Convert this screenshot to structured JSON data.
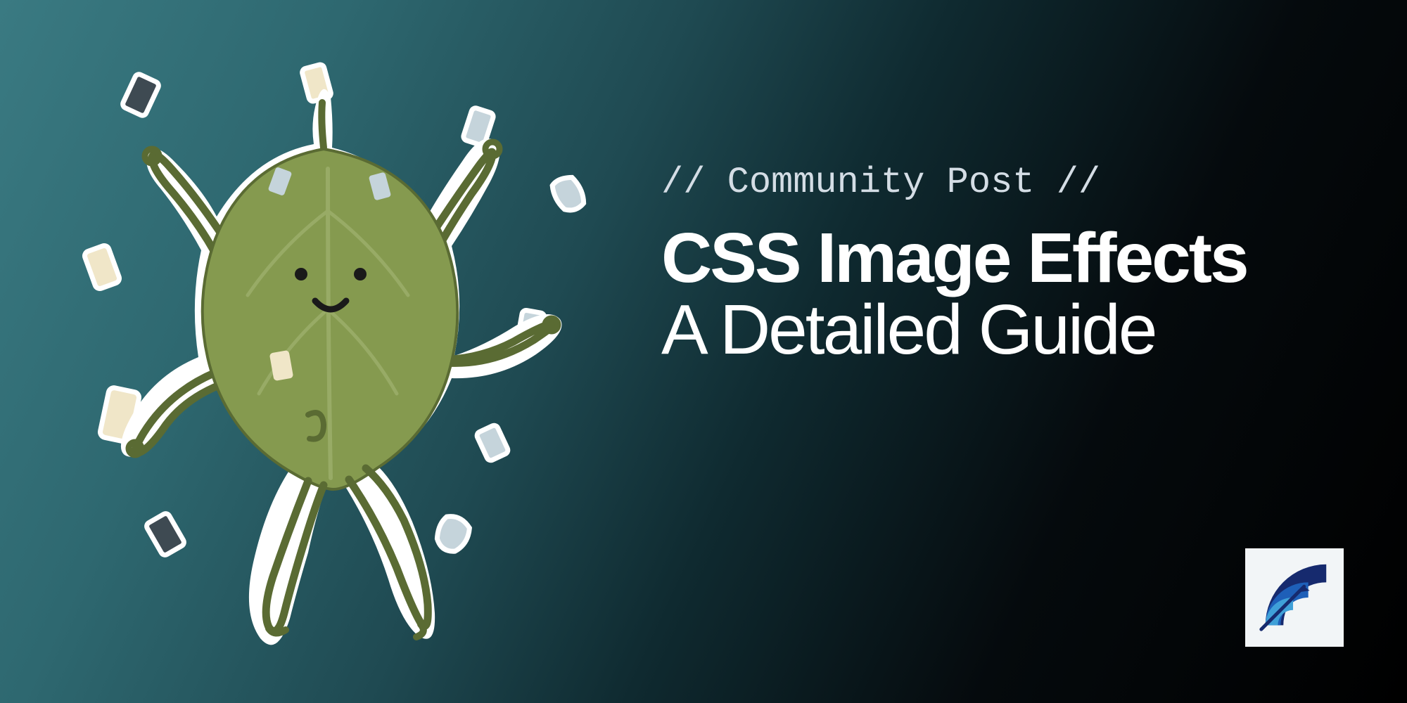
{
  "eyebrow": "// Community Post //",
  "title_bold": "CSS Image Effects",
  "title_light": "A Detailed Guide",
  "illustration_name": "leaf-character-with-confetti",
  "logo_name": "speed-curve-logo",
  "colors": {
    "bg_teal": "#3a7a82",
    "bg_dark": "#000000",
    "text": "#ffffff",
    "eyebrow": "#d4dde5",
    "leaf_fill": "#7c9147",
    "leaf_stroke": "#5a6b33",
    "limb": "#5a6b33",
    "confetti_cream": "#f0e6c8",
    "confetti_blue": "#c5d4db",
    "confetti_dark": "#3e4a52",
    "logo_dark": "#162a6e",
    "logo_mid": "#1e5fb8",
    "logo_light": "#3fa0d8"
  }
}
